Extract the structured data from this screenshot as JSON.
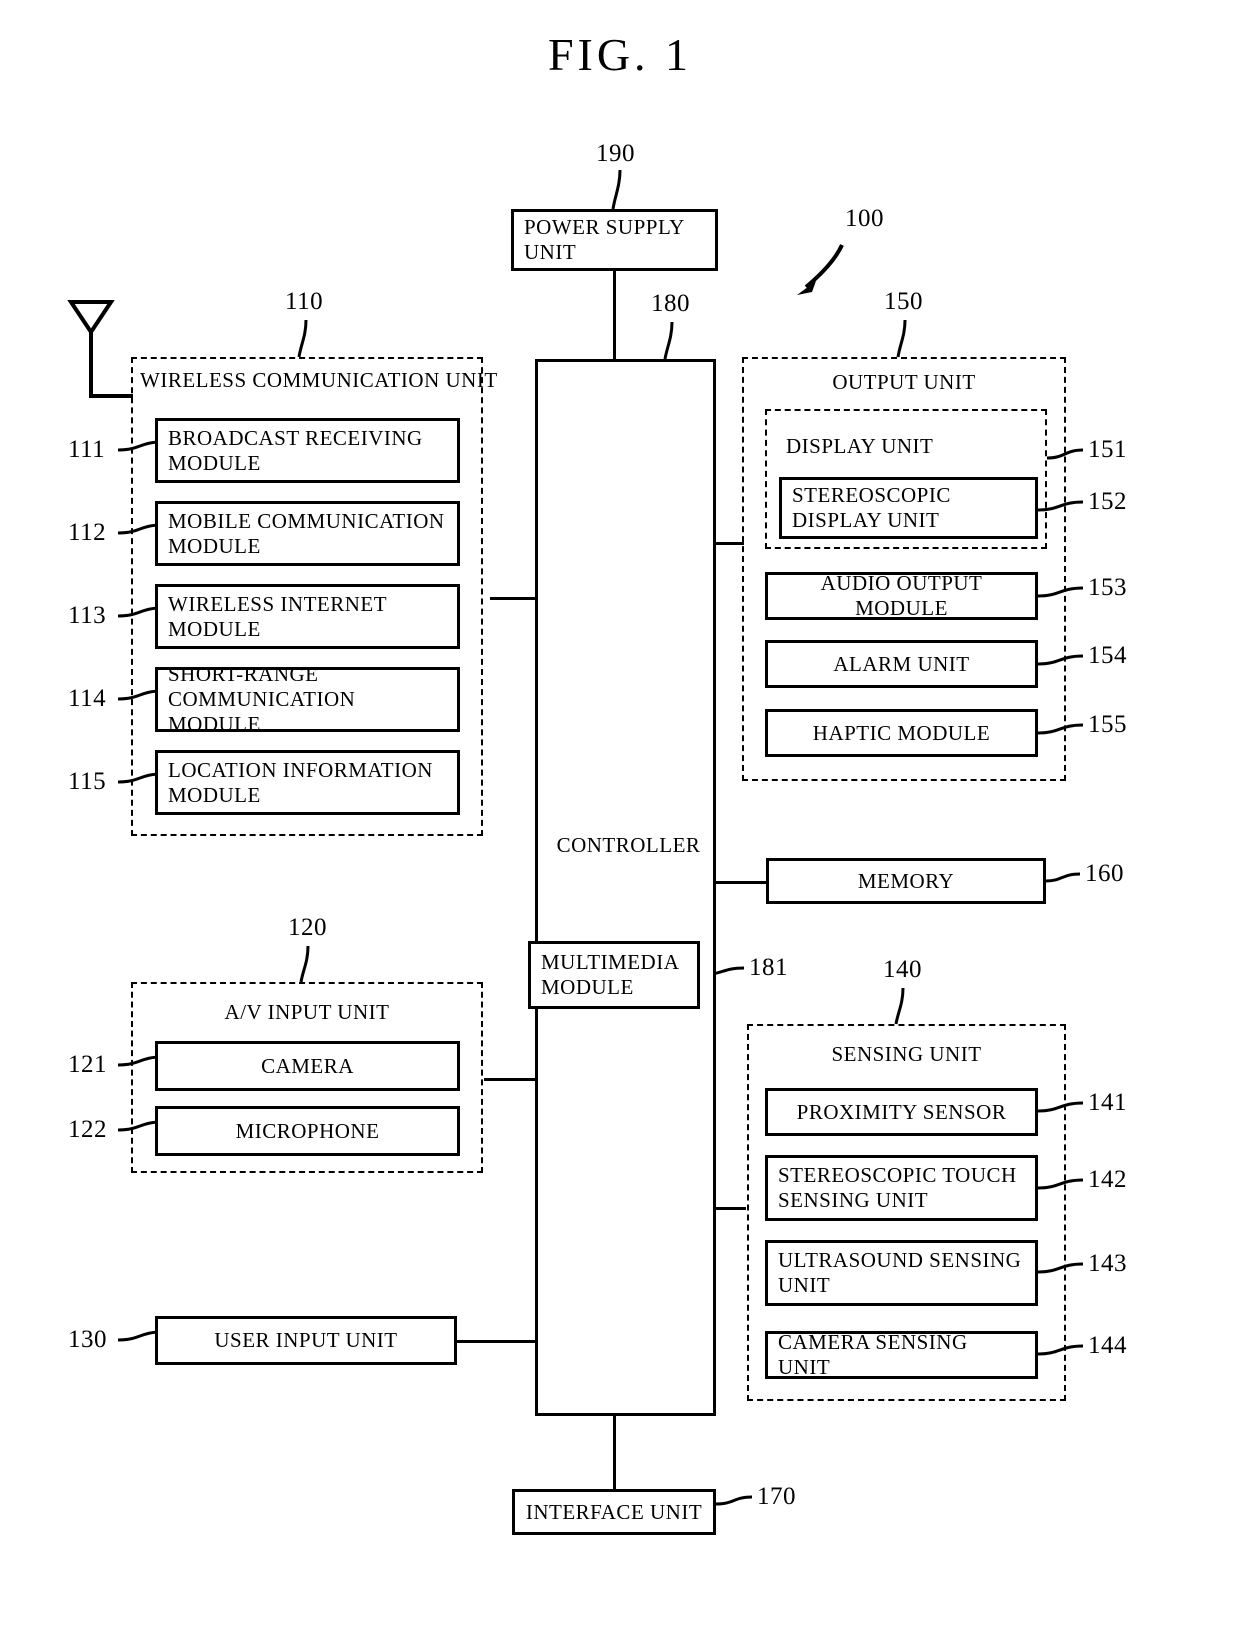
{
  "figure": {
    "title": "FIG.  1",
    "overall_ref": "100"
  },
  "blocks": {
    "power_supply": {
      "label": "POWER SUPPLY UNIT",
      "ref": "190"
    },
    "controller": {
      "label": "CONTROLLER",
      "ref": "180"
    },
    "multimedia": {
      "label": "MULTIMEDIA MODULE",
      "ref": "181"
    },
    "memory": {
      "label": "MEMORY",
      "ref": "160"
    },
    "user_input": {
      "label": "USER INPUT UNIT",
      "ref": "130"
    },
    "interface": {
      "label": "INTERFACE UNIT",
      "ref": "170"
    }
  },
  "wireless_unit": {
    "label": "WIRELESS COMMUNICATION UNIT",
    "ref": "110",
    "items": [
      {
        "label": "BROADCAST RECEIVING MODULE",
        "ref": "111"
      },
      {
        "label": "MOBILE COMMUNICATION MODULE",
        "ref": "112"
      },
      {
        "label": "WIRELESS INTERNET MODULE",
        "ref": "113"
      },
      {
        "label": "SHORT-RANGE COMMUNICATION MODULE",
        "ref": "114"
      },
      {
        "label": "LOCATION INFORMATION MODULE",
        "ref": "115"
      }
    ]
  },
  "av_input_unit": {
    "label": "A/V INPUT UNIT",
    "ref": "120",
    "items": [
      {
        "label": "CAMERA",
        "ref": "121"
      },
      {
        "label": "MICROPHONE",
        "ref": "122"
      }
    ]
  },
  "output_unit": {
    "label": "OUTPUT UNIT",
    "ref": "150",
    "display_unit": {
      "label": "DISPLAY UNIT",
      "ref": "151",
      "items": [
        {
          "label": "STEREOSCOPIC DISPLAY UNIT",
          "ref": "152"
        }
      ]
    },
    "items": [
      {
        "label": "AUDIO OUTPUT MODULE",
        "ref": "153"
      },
      {
        "label": "ALARM UNIT",
        "ref": "154"
      },
      {
        "label": "HAPTIC MODULE",
        "ref": "155"
      }
    ]
  },
  "sensing_unit": {
    "label": "SENSING UNIT",
    "ref": "140",
    "items": [
      {
        "label": "PROXIMITY SENSOR",
        "ref": "141"
      },
      {
        "label": "STEREOSCOPIC TOUCH SENSING UNIT",
        "ref": "142"
      },
      {
        "label": "ULTRASOUND SENSING UNIT",
        "ref": "143"
      },
      {
        "label": "CAMERA SENSING UNIT",
        "ref": "144"
      }
    ]
  },
  "icons": {
    "antenna": "antenna-icon",
    "pointer": "pointer-arrow-icon"
  }
}
